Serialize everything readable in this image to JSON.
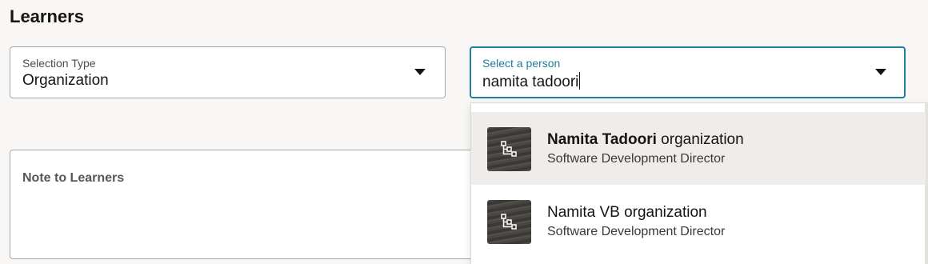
{
  "page": {
    "title": "Learners"
  },
  "selection_type": {
    "label": "Selection Type",
    "value": "Organization"
  },
  "person_select": {
    "label": "Select a person",
    "value": "namita tadoori"
  },
  "note": {
    "label": "Note to Learners"
  },
  "options": [
    {
      "name_bold": "Namita Tadoori",
      "name_rest": " organization",
      "subtitle": "Software Development Director",
      "icon": "org-chart-icon"
    },
    {
      "name_bold": "",
      "name_rest": "Namita VB organization",
      "subtitle": "Software Development Director",
      "icon": "org-chart-icon"
    }
  ],
  "colors": {
    "accent": "#227e9e",
    "highlight": "#eeedeb",
    "background": "#f8f7f5"
  }
}
